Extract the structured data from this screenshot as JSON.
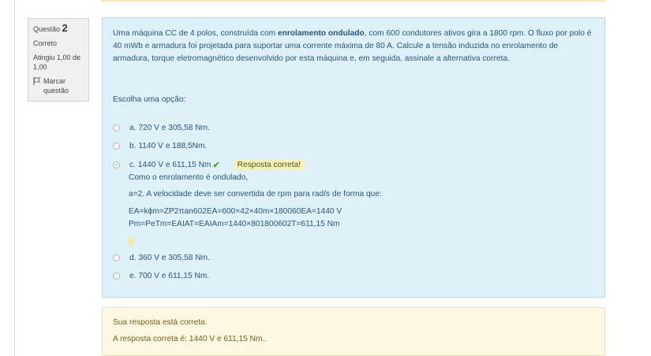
{
  "question_info": {
    "label": "Questão",
    "number": "2",
    "state": "Correto",
    "grade": "Atingiu 1,00 de 1,00",
    "flag_label": "Marcar questão"
  },
  "question": {
    "text_part1": "Uma máquina CC de 4 polos, construída com ",
    "text_bold": "enrolamento ondulado",
    "text_part2": ", com 600 condutores ativos gira a 1800 rpm. O fluxo por polo é 40 mWb e armadura foi projetada para suportar uma corrente máxima de 80 A. Calcule a tensão induzida no enrolamento de armadura, torque eletromagnético desenvolvido por esta máquina e, em seguida, assinale a alternativa correta.",
    "prompt": "Escolha uma opção:"
  },
  "options": [
    {
      "label": "a. 720 V e 305,58 Nm."
    },
    {
      "label": "b. 1140 V e 188,5Nm."
    },
    {
      "label": "c. 1440 V e 611,15 Nm",
      "selected": true,
      "badge": "Resposta correta!"
    },
    {
      "label": "d. 360 V e 305,58 Nm."
    },
    {
      "label": "e. 700 V e 611,15 Nm."
    }
  ],
  "feedback": {
    "line1": "Como o enrolamento é ondulado,",
    "line2": "a=2. A velocidade deve ser convertida de rpm para rad/s de forma que:",
    "line3": "EA=kϕm=ZP2πan602EA=600×42×40m×180060EA=1440 V",
    "line4": "Pm=PeTm=EAIAT=EAIAm=1440×801800602T=611,15 Nm"
  },
  "outcome": {
    "status": "Sua resposta está correta.",
    "right_answer": "A resposta correta é: 1440 V e 611,15 Nm.."
  },
  "colors": {
    "content_bg": "#def0f8",
    "outcome_bg": "#fdf8e2",
    "badge_bg": "#fcf0b6",
    "check": "#5aa02c"
  }
}
